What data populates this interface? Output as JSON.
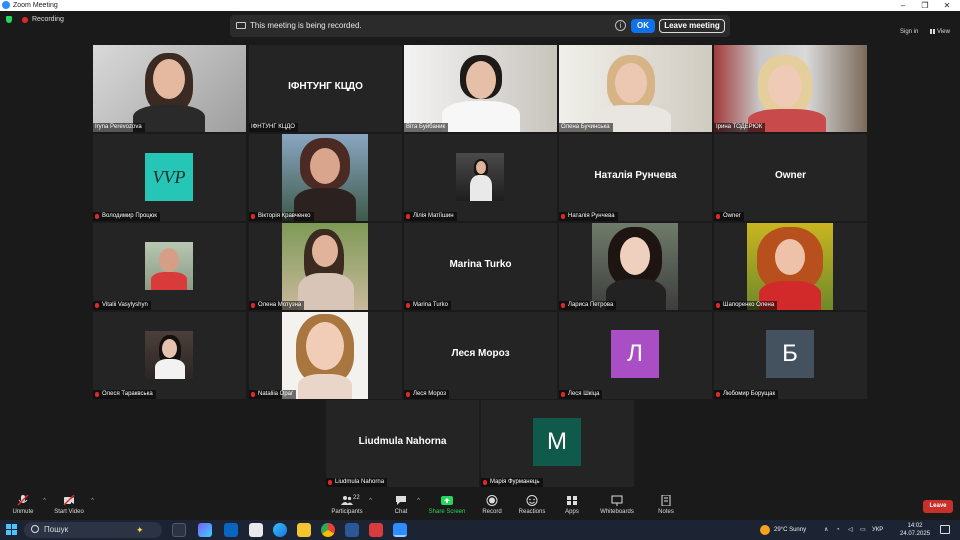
{
  "window": {
    "title": "Zoom Meeting"
  },
  "topbar": {
    "recording_label": "Recording",
    "banner_message": "This meeting is being recorded.",
    "ok_label": "OK",
    "leave_meeting_label": "Leave meeting",
    "sign_in": "Sign in",
    "view": "View"
  },
  "tiles": [
    {
      "name": "Iryna Perevozova",
      "mode": "video",
      "active": true,
      "muted": false
    },
    {
      "name": "ІФНТУНГ КЦДО",
      "mode": "text",
      "display": "ІФНТУНГ КЦДО",
      "muted": false
    },
    {
      "name": "Віта Буйбаник",
      "mode": "video",
      "muted": false
    },
    {
      "name": "Олена Бучинська",
      "mode": "video",
      "muted": false
    },
    {
      "name": "Ірина ТОДЕРЮК",
      "mode": "video",
      "muted": false
    },
    {
      "name": "Володимир Процюк",
      "mode": "logo",
      "logo_text": "VVP",
      "muted": true
    },
    {
      "name": "Вікторія Кравченко",
      "mode": "photo",
      "muted": true
    },
    {
      "name": "Лілія Матіїшин",
      "mode": "photo",
      "muted": true
    },
    {
      "name": "Наталія Рунчева",
      "mode": "text",
      "display": "Наталія Рунчева",
      "muted": true
    },
    {
      "name": "Owner",
      "mode": "text",
      "display": "Owner",
      "muted": true
    },
    {
      "name": "Vitalii Vasylyshyn",
      "mode": "photo",
      "muted": true
    },
    {
      "name": "Олена Мотузна",
      "mode": "photo",
      "muted": true
    },
    {
      "name": "Marina Turko",
      "mode": "text",
      "display": "Marina Turko",
      "muted": true
    },
    {
      "name": "Лариса Петрова",
      "mode": "photo",
      "muted": true
    },
    {
      "name": "Шапоренко Олена",
      "mode": "photo",
      "muted": true
    },
    {
      "name": "Олеся Тараквська",
      "mode": "photo",
      "muted": true
    },
    {
      "name": "Nataliia Oраг",
      "mode": "photo",
      "muted": true
    },
    {
      "name": "Леся Мороз",
      "mode": "text",
      "display": "Леся Мороз",
      "muted": true
    },
    {
      "name": "Леся Шкіца",
      "mode": "letter",
      "letter": "Л",
      "color": "#a94ec4",
      "muted": true
    },
    {
      "name": "Любомир Борущак",
      "mode": "letter",
      "letter": "Б",
      "color": "#44515e",
      "muted": true
    },
    {
      "name": "Liudmula Nahorna",
      "mode": "text",
      "display": "Liudmula Nahorna",
      "muted": true
    },
    {
      "name": "Марія Фурманець",
      "mode": "letter",
      "letter": "М",
      "color": "#0f5a4a",
      "muted": true
    }
  ],
  "toolbar": {
    "unmute": "Unmute",
    "start_video": "Start Video",
    "participants": "Participants",
    "participants_count": "22",
    "chat": "Chat",
    "share_screen": "Share Screen",
    "record": "Record",
    "reactions": "Reactions",
    "apps": "Apps",
    "whiteboards": "Whiteboards",
    "notes": "Notes",
    "leave": "Leave"
  },
  "taskbar": {
    "search_placeholder": "Пошук",
    "weather": "29°C  Sunny",
    "lang": "УКР",
    "time": "14:02",
    "date": "24.07.2025"
  },
  "colors": {
    "accent": "#0e72ed",
    "share_green": "#23d959",
    "leave_red": "#c8302a",
    "active_border": "#d8e26a"
  }
}
